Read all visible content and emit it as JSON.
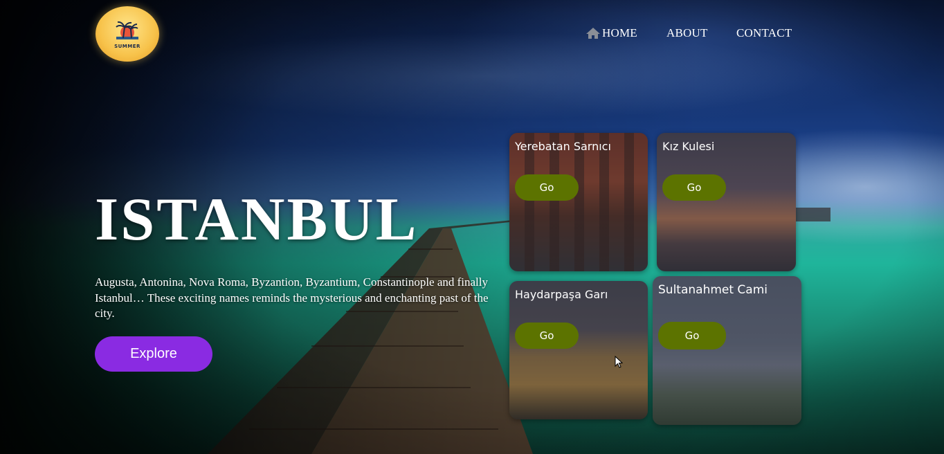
{
  "brand": {
    "logo_text": "SUMMER"
  },
  "nav": {
    "home": "HOME",
    "about": "ABOUT",
    "contact": "CONTACT"
  },
  "hero": {
    "title": "ISTANBUL",
    "description": "Augusta, Antonina, Nova Roma, Byzantion, Byzantium, Constantinople and finally Istanbul… These exciting names reminds the mysterious and enchanting past of the city.",
    "cta_label": "Explore"
  },
  "cards": [
    {
      "title": "Yerebatan Sarnıcı",
      "button": "Go"
    },
    {
      "title": "Kız Kulesi",
      "button": "Go"
    },
    {
      "title": "Haydarpaşa Garı",
      "button": "Go"
    },
    {
      "title": "Sultanahmet Cami",
      "button": "Go"
    }
  ],
  "colors": {
    "cta": "#8a2be2",
    "card_button": "#5c7300",
    "text": "#ffffff"
  }
}
